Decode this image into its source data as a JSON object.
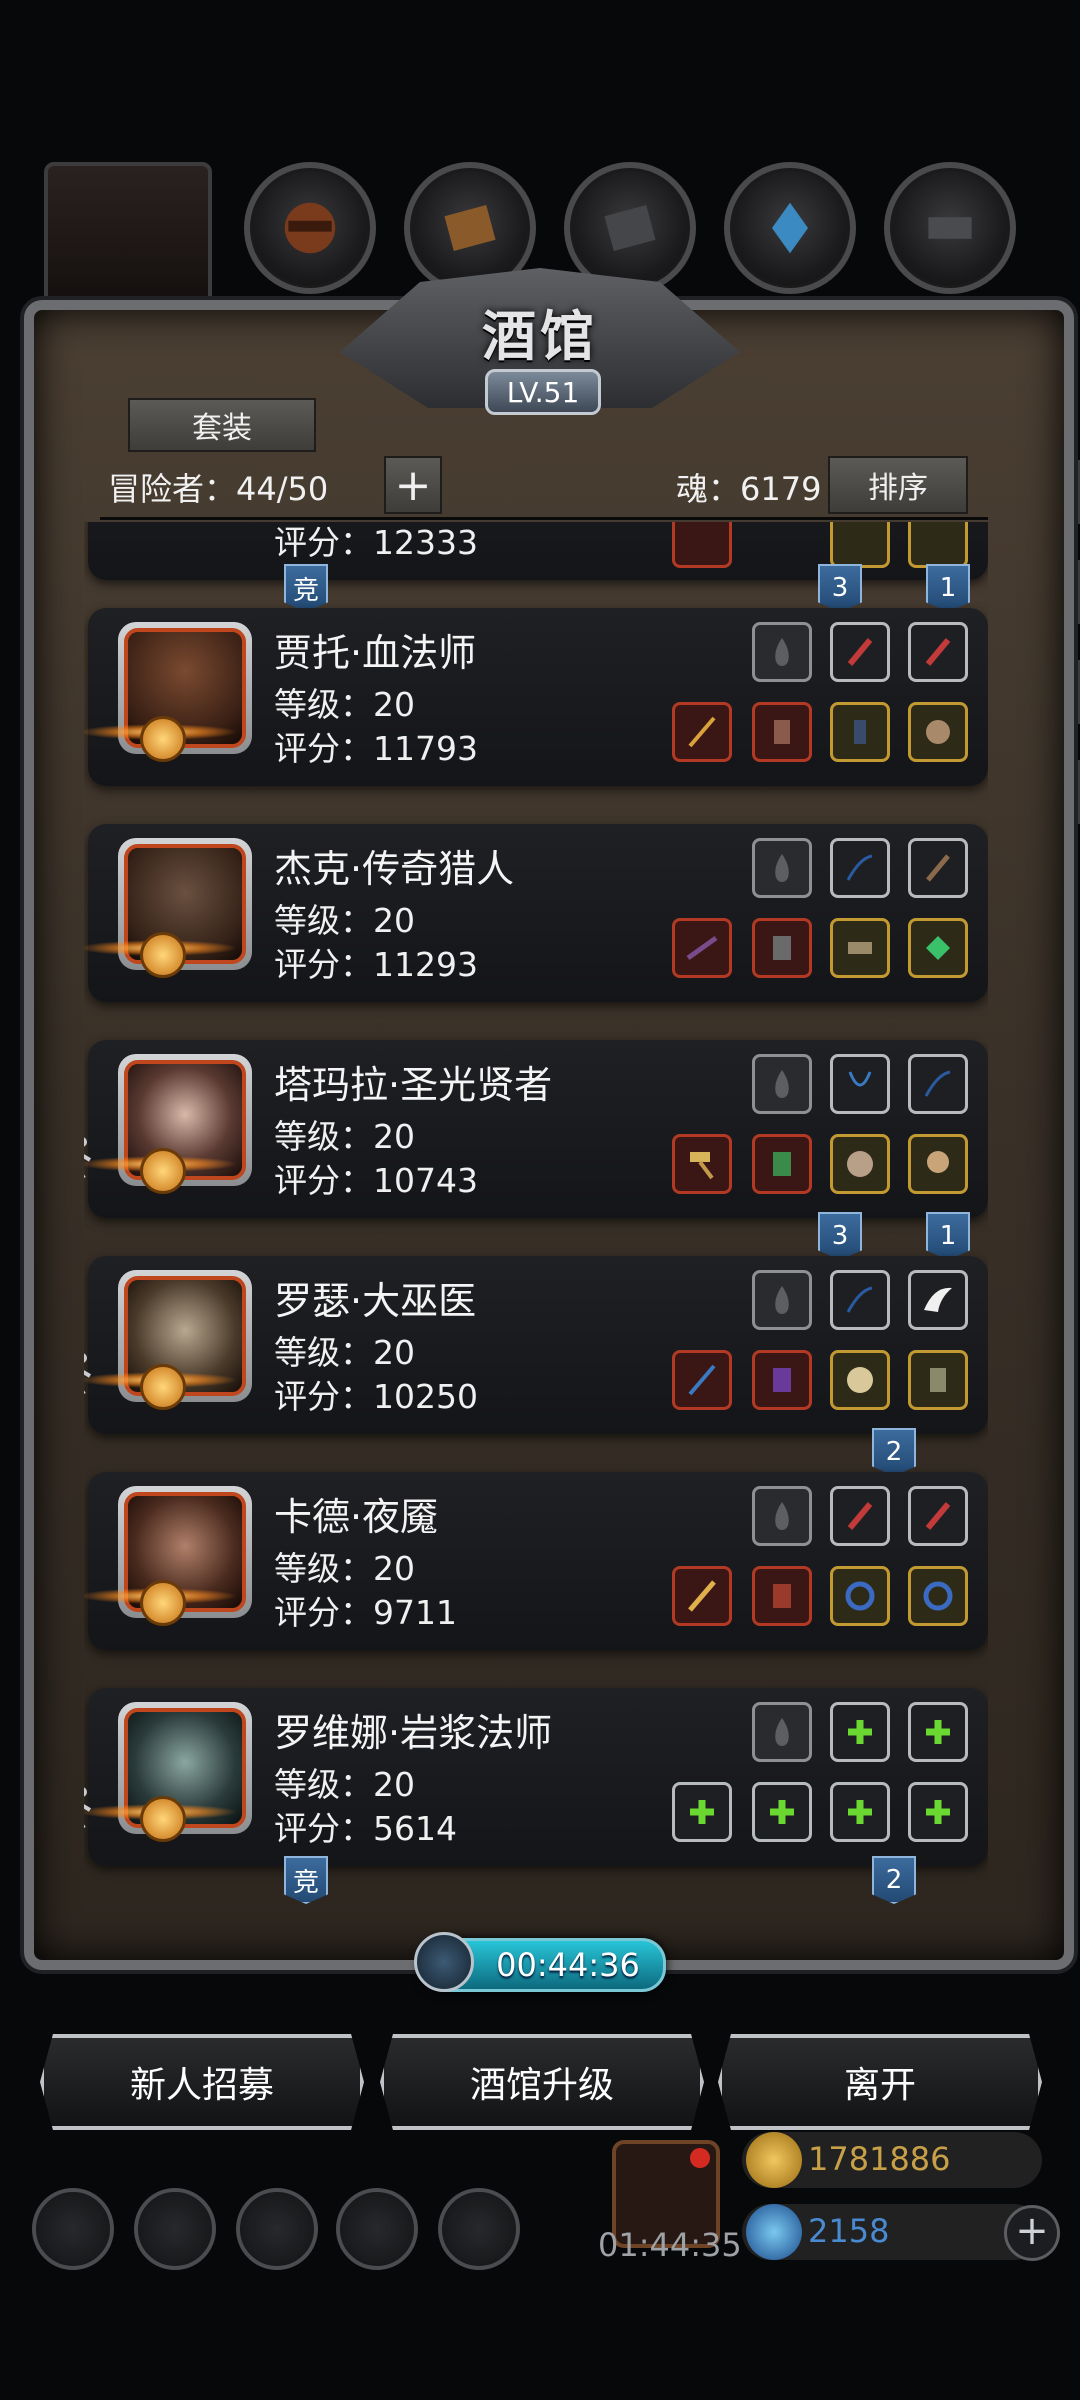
{
  "panel": {
    "title": "酒馆",
    "level": "LV.51",
    "set_button": "套装",
    "adventurers_label": "冒险者：44/50",
    "soul_label": "魂：6179",
    "sort_button": "排序",
    "add_symbol": "+"
  },
  "top_tabs": [
    "avatar-tab",
    "category-tab-1",
    "category-tab-2",
    "category-tab-3",
    "category-tab-4",
    "category-tab-5"
  ],
  "partial_card": {
    "score": "评分：12333"
  },
  "ribbons_top": {
    "left": "竞",
    "mid": "3",
    "right": "1"
  },
  "heroes": [
    {
      "name": "贾托·血法师",
      "level": "等级：20",
      "score": "评分：11793"
    },
    {
      "name": "杰克·传奇猎人",
      "level": "等级：20",
      "score": "评分：11293"
    },
    {
      "name": "塔玛拉·圣光贤者",
      "level": "等级：20",
      "score": "评分：10743"
    },
    {
      "name": "罗瑟·大巫医",
      "level": "等级：20",
      "score": "评分：10250"
    },
    {
      "name": "卡德·夜魇",
      "level": "等级：20",
      "score": "评分：9711"
    },
    {
      "name": "罗维娜·岩浆法师",
      "level": "等级：20",
      "score": "评分：5614"
    }
  ],
  "ribbons": {
    "after_hero3_mid": "3",
    "after_hero3_right": "1",
    "after_hero4": "2",
    "after_hero6_left": "竞",
    "after_hero6_right": "2"
  },
  "timer": "00:44:36",
  "actions": {
    "recruit": "新人招募",
    "upgrade": "酒馆升级",
    "leave": "离开"
  },
  "bottom": {
    "gift_timer": "01:44:35",
    "gold": "1781886",
    "gems": "2158"
  },
  "colors": {
    "panel": "#3a3128",
    "accent_gold": "#c39a32",
    "accent_red": "#b23a25",
    "timer": "#28c5d8"
  }
}
